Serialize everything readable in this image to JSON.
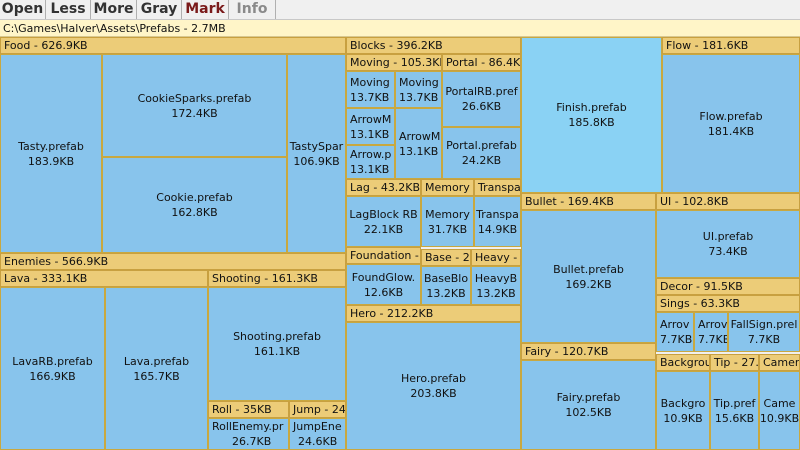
{
  "toolbar": {
    "open": "Open",
    "less": "Less",
    "more": "More",
    "gray": "Gray",
    "mark": "Mark",
    "info": "Info"
  },
  "path": "C:\\Games\\Halver\\Assets\\Prefabs - 2.7MB",
  "colors": {
    "tile": "#88c4ec",
    "tile_selected": "#8ad2f4",
    "header": "#eccc78",
    "mark_text": "#7a1a1a",
    "info_text": "#8a8a8a"
  },
  "headers": {
    "food": "Food - 626.9KB",
    "enemies": "Enemies - 566.9KB",
    "lava": "Lava - 333.1KB",
    "shooting": "Shooting - 161.3KB",
    "roll": "Roll - 35KB",
    "jump": "Jump - 24",
    "blocks": "Blocks - 396.2KB",
    "moving": "Moving - 105.3KB",
    "portal": "Portal - 86.4KB",
    "lag": "Lag - 43.2KB",
    "memory": "Memory",
    "transparent": "Transpa",
    "foundation": "Foundation -",
    "base": "Base - 24",
    "heavy": "Heavy -",
    "hero": "Hero - 212.2KB",
    "bullet": "Bullet - 169.4KB",
    "fairy": "Fairy - 120.7KB",
    "flow": "Flow - 181.6KB",
    "ui": "UI - 102.8KB",
    "decor": "Decor - 91.5KB",
    "sings": "Sings - 63.3KB",
    "tip": "Tip - 27.",
    "camera": "Camer"
  },
  "tiles": {
    "tasty": {
      "name": "Tasty.prefab",
      "size": "183.9KB"
    },
    "cookie_sparks": {
      "name": "CookieSparks.prefab",
      "size": "172.4KB"
    },
    "tasty_sparks": {
      "name": "TastySpar",
      "size": "106.9KB"
    },
    "cookie": {
      "name": "Cookie.prefab",
      "size": "162.8KB"
    },
    "lava_rb": {
      "name": "LavaRB.prefab",
      "size": "166.9KB"
    },
    "lava": {
      "name": "Lava.prefab",
      "size": "165.7KB"
    },
    "shooting": {
      "name": "Shooting.prefab",
      "size": "161.1KB"
    },
    "roll_enemy": {
      "name": "RollEnemy.pr",
      "size": "26.7KB"
    },
    "jump_enemy": {
      "name": "JumpEne",
      "size": "24.6KB"
    },
    "moving1": {
      "name": "Moving",
      "size": "13.7KB"
    },
    "moving2": {
      "name": "Moving",
      "size": "13.7KB"
    },
    "arrow1": {
      "name": "ArrowM",
      "size": "13.1KB"
    },
    "arrow2": {
      "name": "ArrowM",
      "size": "13.1KB"
    },
    "arrow3": {
      "name": "Arrow.p",
      "size": "13.1KB"
    },
    "portal_rb": {
      "name": "PortalRB.pref",
      "size": "26.6KB"
    },
    "portal": {
      "name": "Portal.prefab",
      "size": "24.2KB"
    },
    "lag_block": {
      "name": "LagBlock RB",
      "size": "22.1KB"
    },
    "memory": {
      "name": "Memory",
      "size": "31.7KB"
    },
    "transparent": {
      "name": "Transpa",
      "size": "14.9KB"
    },
    "found_glow": {
      "name": "FoundGlow.",
      "size": "12.6KB"
    },
    "base_block": {
      "name": "BaseBlo",
      "size": "13.2KB"
    },
    "heavy_block": {
      "name": "HeavyB",
      "size": "13.2KB"
    },
    "hero": {
      "name": "Hero.prefab",
      "size": "203.8KB"
    },
    "finish": {
      "name": "Finish.prefab",
      "size": "185.8KB"
    },
    "bullet": {
      "name": "Bullet.prefab",
      "size": "169.2KB"
    },
    "fairy": {
      "name": "Fairy.prefab",
      "size": "102.5KB"
    },
    "flow": {
      "name": "Flow.prefab",
      "size": "181.4KB"
    },
    "ui": {
      "name": "UI.prefab",
      "size": "73.4KB"
    },
    "arrow_sign1": {
      "name": "Arrov",
      "size": "7.7KB"
    },
    "arrow_sign2": {
      "name": "Arrov",
      "size": "7.7KB"
    },
    "fall_sign": {
      "name": "FallSign.prel",
      "size": "7.7KB"
    },
    "background_hdr": {
      "name": "Backgrou",
      "size": ""
    },
    "background": {
      "name": "Backgro",
      "size": "10.9KB"
    },
    "tip": {
      "name": "Tip.pref",
      "size": "15.6KB"
    },
    "camera": {
      "name": "Came",
      "size": "10.9KB"
    }
  }
}
